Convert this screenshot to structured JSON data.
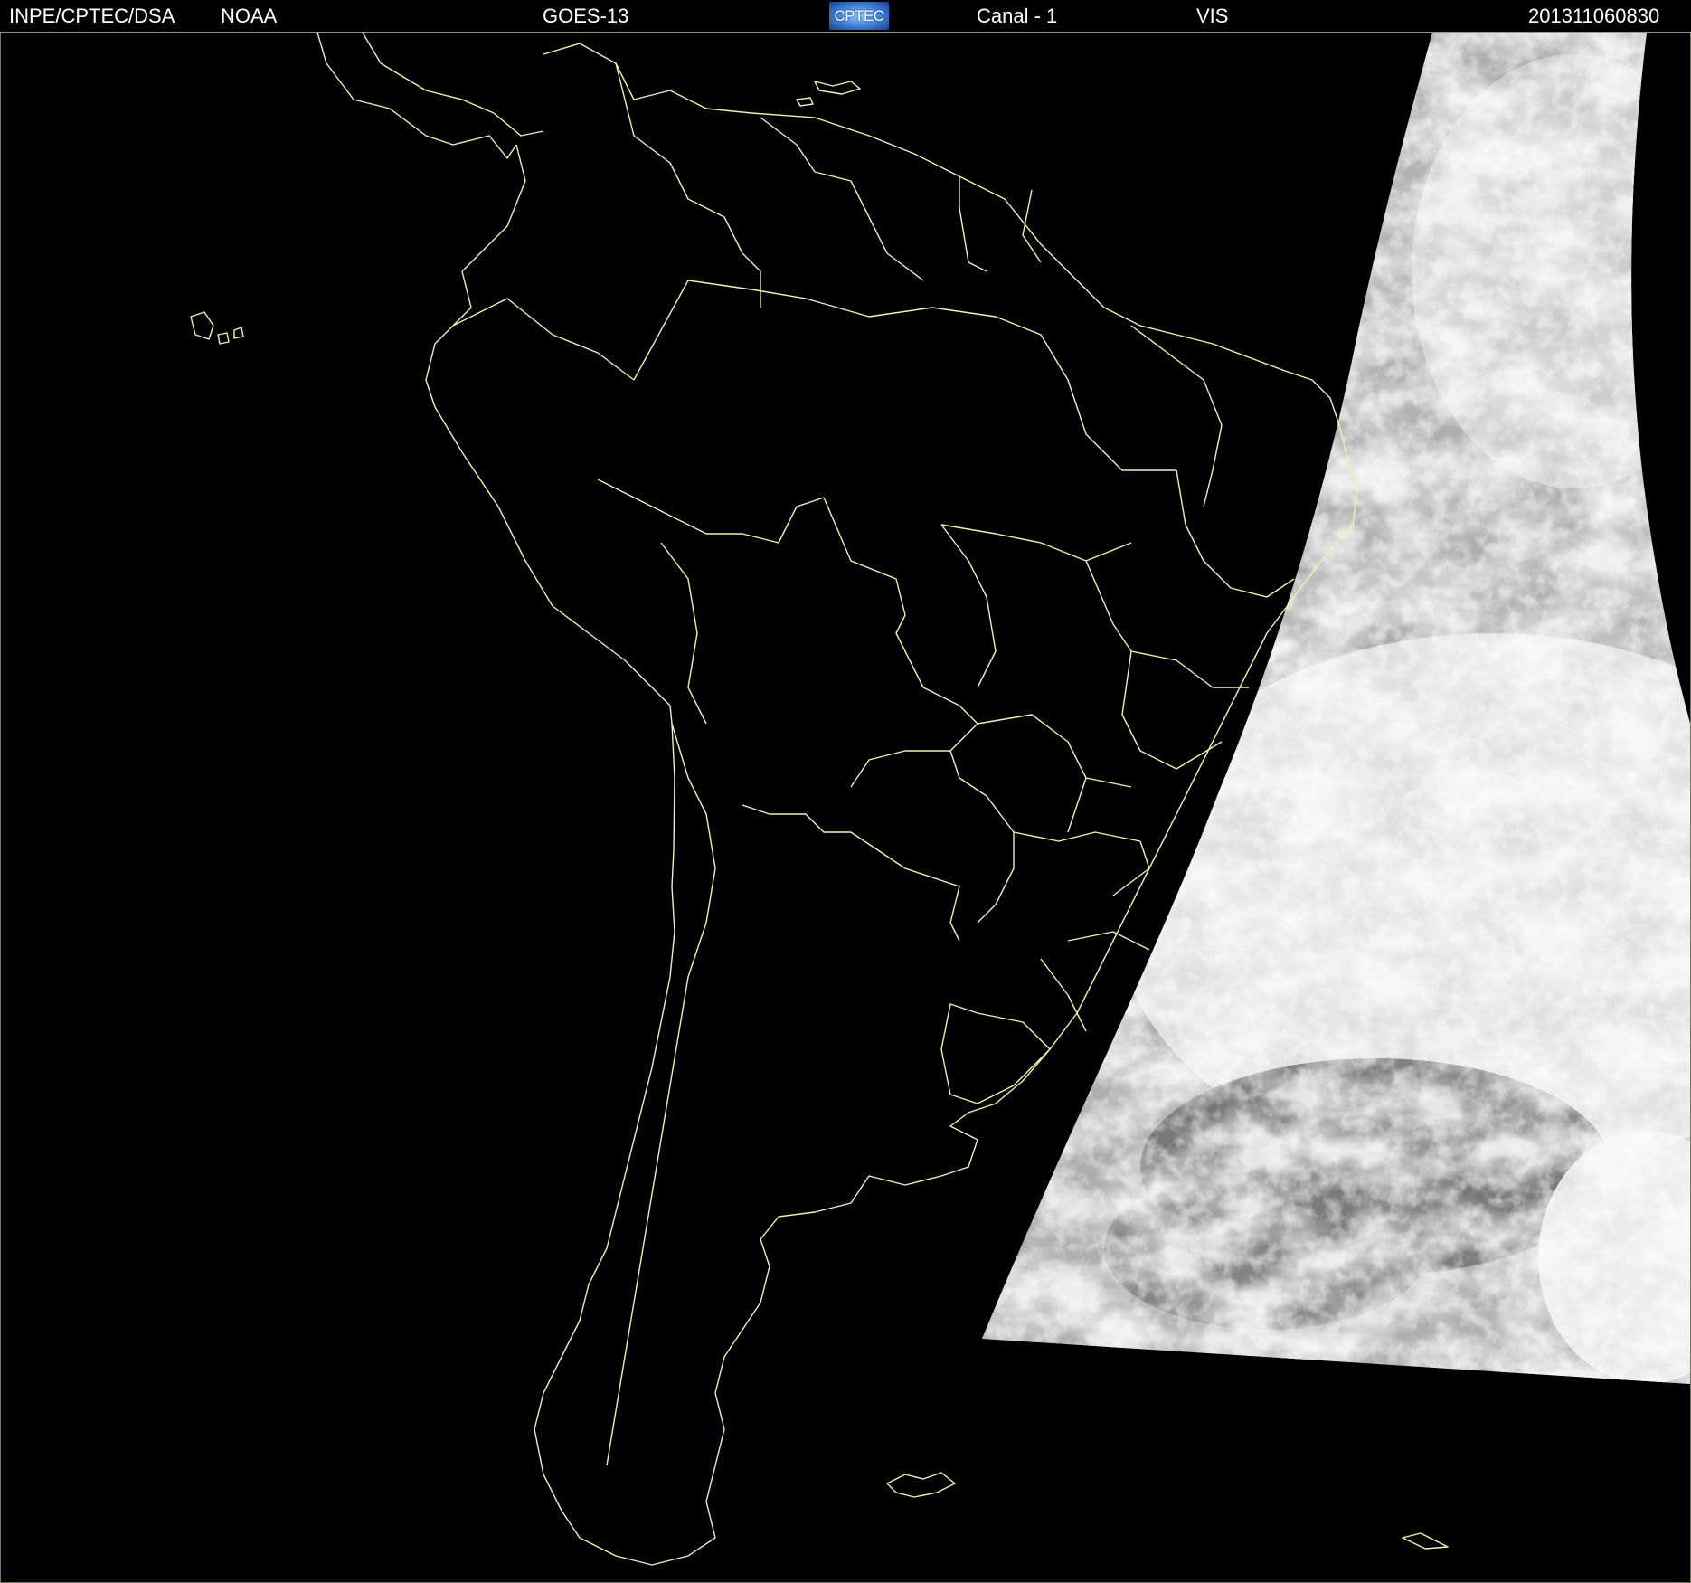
{
  "header": {
    "agency": "INPE/CPTEC/DSA",
    "source": "NOAA",
    "satellite": "GOES-13",
    "logo_text": "CPTEC",
    "channel": "Canal - 1",
    "band": "VIS",
    "timestamp": "201311060830"
  },
  "map": {
    "border_color": "#f2f2b0",
    "background": "#000000",
    "cloud_colors": [
      "#f4f4f4",
      "#d6d6d6",
      "#9c9c9c",
      "#6e6e6e"
    ]
  }
}
